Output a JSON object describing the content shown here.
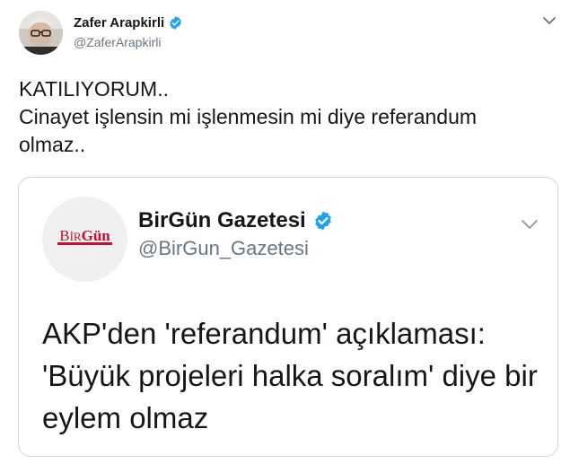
{
  "tweet": {
    "author": {
      "name": "Zafer Arapkirli",
      "handle": "@ZaferArapkirli",
      "verified": true
    },
    "text": "KATILIYORUM..\nCinayet işlensin mi işlenmesin mi diye referandum olmaz..",
    "colors": {
      "verified": "#1da1f2",
      "secondary_text": "#657786",
      "border": "#ccd6dd"
    }
  },
  "quoted_tweet": {
    "author": {
      "name": "BirGün Gazetesi",
      "handle": "@BirGun_Gazetesi",
      "verified": true,
      "avatar_logo_text": "BirGün",
      "avatar_logo_color": "#c8102e"
    },
    "text": "AKP'den 'referandum' açıklaması:\n'Büyük projeleri halka soralım' diye bir eylem olmaz"
  }
}
